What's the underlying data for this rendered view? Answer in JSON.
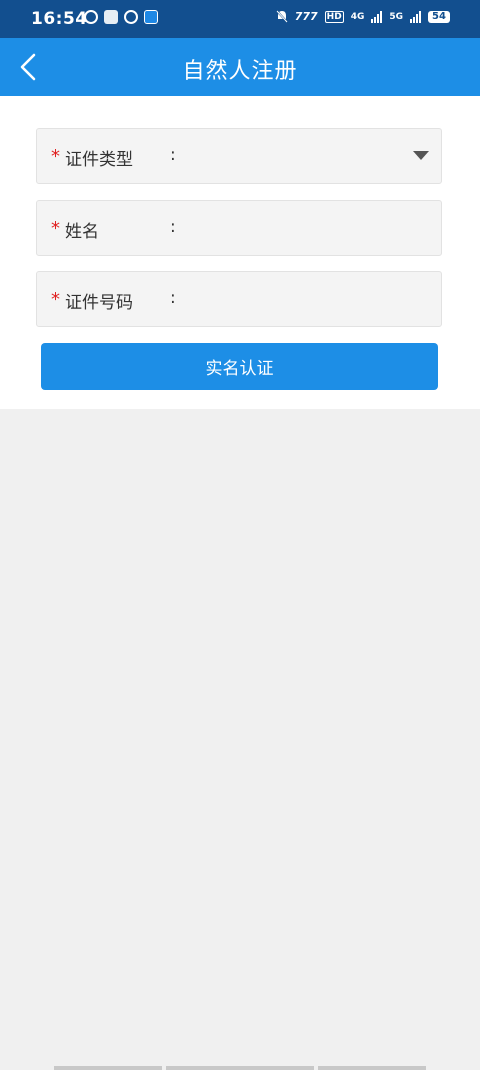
{
  "status_bar": {
    "time": "16:54",
    "network_4g": "4G",
    "network_5g": "5G",
    "hd": "HD",
    "battery": "54"
  },
  "nav": {
    "title": "自然人注册"
  },
  "form": {
    "required_mark": "*",
    "colon": ":",
    "fields": [
      {
        "label": "证件类型",
        "value": ""
      },
      {
        "label": "姓名",
        "value": ""
      },
      {
        "label": "证件号码",
        "value": ""
      }
    ],
    "submit_label": "实名认证"
  },
  "colors": {
    "status_bar": "#124f8f",
    "primary": "#1d8ee6",
    "required": "#e02020"
  }
}
